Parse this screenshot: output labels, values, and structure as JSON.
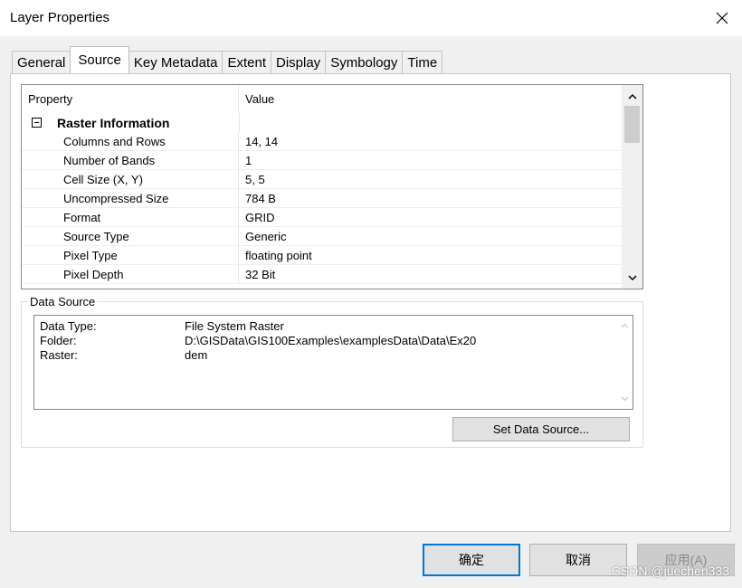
{
  "window": {
    "title": "Layer Properties"
  },
  "tabs": [
    "General",
    "Source",
    "Key Metadata",
    "Extent",
    "Display",
    "Symbology",
    "Time"
  ],
  "active_tab": "Source",
  "grid": {
    "header": {
      "property": "Property",
      "value": "Value"
    },
    "group": {
      "label": "Raster Information"
    },
    "rows": [
      {
        "property": "Columns and Rows",
        "value": "14, 14"
      },
      {
        "property": "Number of Bands",
        "value": "1"
      },
      {
        "property": "Cell Size (X, Y)",
        "value": "5, 5"
      },
      {
        "property": "Uncompressed Size",
        "value": "784 B"
      },
      {
        "property": "Format",
        "value": "GRID"
      },
      {
        "property": "Source Type",
        "value": "Generic"
      },
      {
        "property": "Pixel Type",
        "value": "floating point"
      },
      {
        "property": "Pixel Depth",
        "value": "32 Bit"
      }
    ]
  },
  "data_source": {
    "legend": "Data Source",
    "lines": [
      {
        "key": "Data Type:",
        "value": "File System Raster"
      },
      {
        "key": "Folder:",
        "value": "D:\\GISData\\GIS100Examples\\examplesData\\Data\\Ex20"
      },
      {
        "key": "Raster:",
        "value": "dem"
      }
    ],
    "button_label": "Set Data Source..."
  },
  "buttons": {
    "ok": "确定",
    "cancel": "取消",
    "apply": "应用(A)"
  },
  "watermark": "CSDN @juechen333",
  "colors": {
    "primary_border": "#0078d7",
    "panel": "#ffffff",
    "chrome": "#f0f0f0"
  }
}
